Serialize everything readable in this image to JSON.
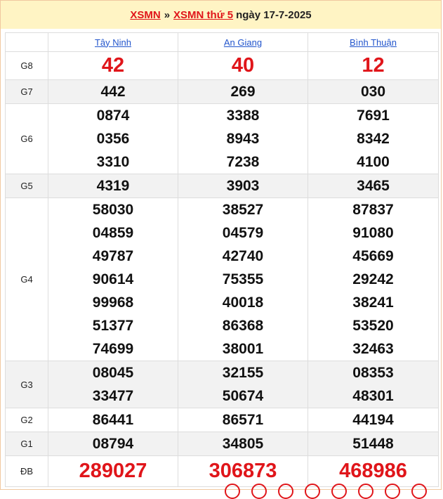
{
  "header": {
    "link1": "XSMN",
    "separator": "»",
    "link2": "XSMN thứ 5",
    "date_text": "ngày 17-7-2025"
  },
  "provinces": [
    "Tây Ninh",
    "An Giang",
    "Bình Thuận"
  ],
  "prizes": [
    {
      "label": "G8",
      "values": [
        [
          "42"
        ],
        [
          "40"
        ],
        [
          "12"
        ]
      ]
    },
    {
      "label": "G7",
      "values": [
        [
          "442"
        ],
        [
          "269"
        ],
        [
          "030"
        ]
      ]
    },
    {
      "label": "G6",
      "values": [
        [
          "0874",
          "0356",
          "3310"
        ],
        [
          "3388",
          "8943",
          "7238"
        ],
        [
          "7691",
          "8342",
          "4100"
        ]
      ]
    },
    {
      "label": "G5",
      "values": [
        [
          "4319"
        ],
        [
          "3903"
        ],
        [
          "3465"
        ]
      ]
    },
    {
      "label": "G4",
      "values": [
        [
          "58030",
          "04859",
          "49787",
          "90614",
          "99968",
          "51377",
          "74699"
        ],
        [
          "38527",
          "04579",
          "42740",
          "75355",
          "40018",
          "86368",
          "38001"
        ],
        [
          "87837",
          "91080",
          "45669",
          "29242",
          "38241",
          "53520",
          "32463"
        ]
      ]
    },
    {
      "label": "G3",
      "values": [
        [
          "08045",
          "33477"
        ],
        [
          "32155",
          "50674"
        ],
        [
          "08353",
          "48301"
        ]
      ]
    },
    {
      "label": "G2",
      "values": [
        [
          "86441"
        ],
        [
          "86571"
        ],
        [
          "44194"
        ]
      ]
    },
    {
      "label": "G1",
      "values": [
        [
          "08794"
        ],
        [
          "34805"
        ],
        [
          "51448"
        ]
      ]
    },
    {
      "label": "ĐB",
      "values": [
        [
          "289027"
        ],
        [
          "306873"
        ],
        [
          "468986"
        ]
      ]
    }
  ],
  "colors": {
    "accent_red": "#e0151a",
    "header_bg": "#fff4c4",
    "link_blue": "#2255cc",
    "alt_row": "#f2f2f2"
  }
}
